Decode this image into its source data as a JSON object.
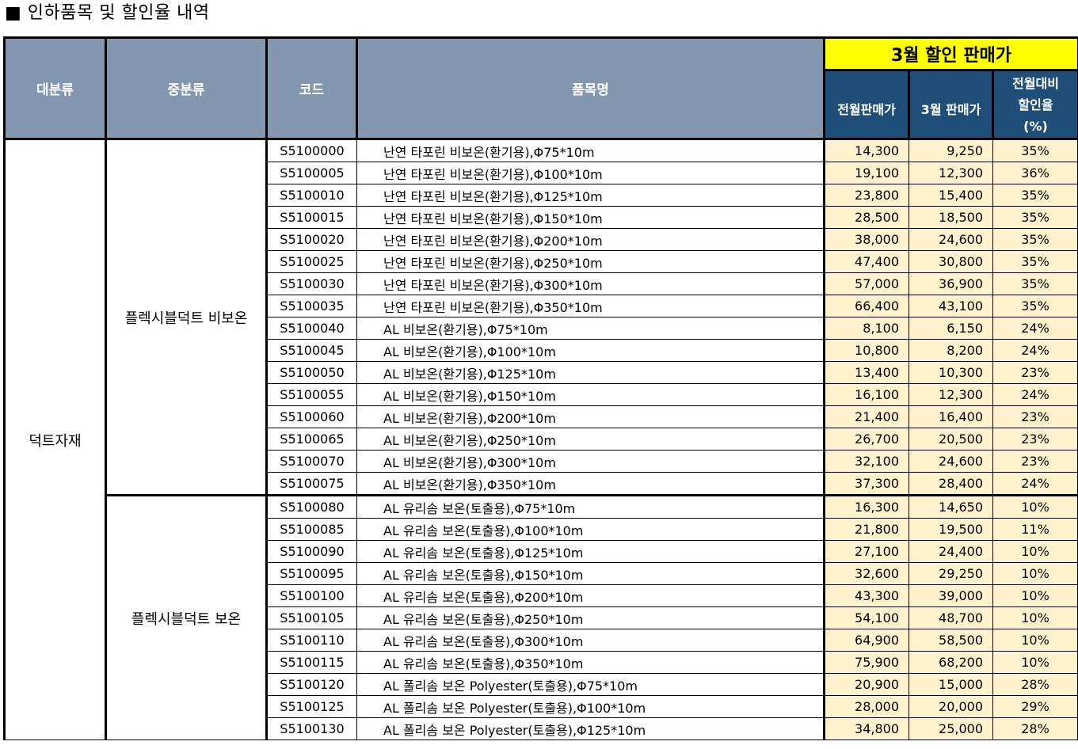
{
  "title": "■ 인하품목 및 할인율 내역",
  "headers": {
    "category": "대분류",
    "subcategory": "중분류",
    "code": "코드",
    "name": "품목명",
    "sale_group": "3월 할인 판매가",
    "prev_price": "전월판매가",
    "mar_price": "3월 판매가",
    "discount_l1": "전월대비",
    "discount_l2": "할인율",
    "discount_l3": "(%)"
  },
  "category": "덕트자재",
  "groups": [
    {
      "subcategory": "플렉시블덕트 비보온",
      "rows": [
        {
          "code": "S5100000",
          "name": "난연 타포린 비보온(환기용),Φ75*10m",
          "prev": "14,300",
          "mar": "9,250",
          "pct": "35%"
        },
        {
          "code": "S5100005",
          "name": "난연 타포린 비보온(환기용),Φ100*10m",
          "prev": "19,100",
          "mar": "12,300",
          "pct": "36%"
        },
        {
          "code": "S5100010",
          "name": "난연 타포린 비보온(환기용),Φ125*10m",
          "prev": "23,800",
          "mar": "15,400",
          "pct": "35%"
        },
        {
          "code": "S5100015",
          "name": "난연 타포린 비보온(환기용),Φ150*10m",
          "prev": "28,500",
          "mar": "18,500",
          "pct": "35%"
        },
        {
          "code": "S5100020",
          "name": "난연 타포린 비보온(환기용),Φ200*10m",
          "prev": "38,000",
          "mar": "24,600",
          "pct": "35%"
        },
        {
          "code": "S5100025",
          "name": "난연 타포린 비보온(환기용),Φ250*10m",
          "prev": "47,400",
          "mar": "30,800",
          "pct": "35%"
        },
        {
          "code": "S5100030",
          "name": "난연 타포린 비보온(환기용),Φ300*10m",
          "prev": "57,000",
          "mar": "36,900",
          "pct": "35%"
        },
        {
          "code": "S5100035",
          "name": "난연 타포린 비보온(환기용),Φ350*10m",
          "prev": "66,400",
          "mar": "43,100",
          "pct": "35%"
        },
        {
          "code": "S5100040",
          "name": "AL 비보온(환기용),Φ75*10m",
          "prev": "8,100",
          "mar": "6,150",
          "pct": "24%"
        },
        {
          "code": "S5100045",
          "name": "AL 비보온(환기용),Φ100*10m",
          "prev": "10,800",
          "mar": "8,200",
          "pct": "24%"
        },
        {
          "code": "S5100050",
          "name": "AL 비보온(환기용),Φ125*10m",
          "prev": "13,400",
          "mar": "10,300",
          "pct": "23%"
        },
        {
          "code": "S5100055",
          "name": "AL 비보온(환기용),Φ150*10m",
          "prev": "16,100",
          "mar": "12,300",
          "pct": "24%"
        },
        {
          "code": "S5100060",
          "name": "AL 비보온(환기용),Φ200*10m",
          "prev": "21,400",
          "mar": "16,400",
          "pct": "23%"
        },
        {
          "code": "S5100065",
          "name": "AL 비보온(환기용),Φ250*10m",
          "prev": "26,700",
          "mar": "20,500",
          "pct": "23%"
        },
        {
          "code": "S5100070",
          "name": "AL 비보온(환기용),Φ300*10m",
          "prev": "32,100",
          "mar": "24,600",
          "pct": "23%"
        },
        {
          "code": "S5100075",
          "name": "AL 비보온(환기용),Φ350*10m",
          "prev": "37,300",
          "mar": "28,400",
          "pct": "24%"
        }
      ]
    },
    {
      "subcategory": "플렉시블덕트 보온",
      "rows": [
        {
          "code": "S5100080",
          "name": "AL 유리솜 보온(토출용),Φ75*10m",
          "prev": "16,300",
          "mar": "14,650",
          "pct": "10%"
        },
        {
          "code": "S5100085",
          "name": "AL 유리솜 보온(토출용),Φ100*10m",
          "prev": "21,800",
          "mar": "19,500",
          "pct": "11%"
        },
        {
          "code": "S5100090",
          "name": "AL 유리솜 보온(토출용),Φ125*10m",
          "prev": "27,100",
          "mar": "24,400",
          "pct": "10%"
        },
        {
          "code": "S5100095",
          "name": "AL 유리솜 보온(토출용),Φ150*10m",
          "prev": "32,600",
          "mar": "29,250",
          "pct": "10%"
        },
        {
          "code": "S5100100",
          "name": "AL 유리솜 보온(토출용),Φ200*10m",
          "prev": "43,300",
          "mar": "39,000",
          "pct": "10%"
        },
        {
          "code": "S5100105",
          "name": "AL 유리솜 보온(토출용),Φ250*10m",
          "prev": "54,100",
          "mar": "48,700",
          "pct": "10%"
        },
        {
          "code": "S5100110",
          "name": "AL 유리솜 보온(토출용),Φ300*10m",
          "prev": "64,900",
          "mar": "58,500",
          "pct": "10%"
        },
        {
          "code": "S5100115",
          "name": "AL 유리솜 보온(토출용),Φ350*10m",
          "prev": "75,900",
          "mar": "68,200",
          "pct": "10%"
        },
        {
          "code": "S5100120",
          "name": "AL 폴리솜 보온 Polyester(토출용),Φ75*10m",
          "prev": "20,900",
          "mar": "15,000",
          "pct": "28%"
        },
        {
          "code": "S5100125",
          "name": "AL 폴리솜 보온 Polyester(토출용),Φ100*10m",
          "prev": "28,000",
          "mar": "20,000",
          "pct": "29%"
        },
        {
          "code": "S5100130",
          "name": "AL 폴리솜 보온 Polyester(토출용),Φ125*10m",
          "prev": "34,800",
          "mar": "25,000",
          "pct": "28%"
        }
      ]
    }
  ]
}
